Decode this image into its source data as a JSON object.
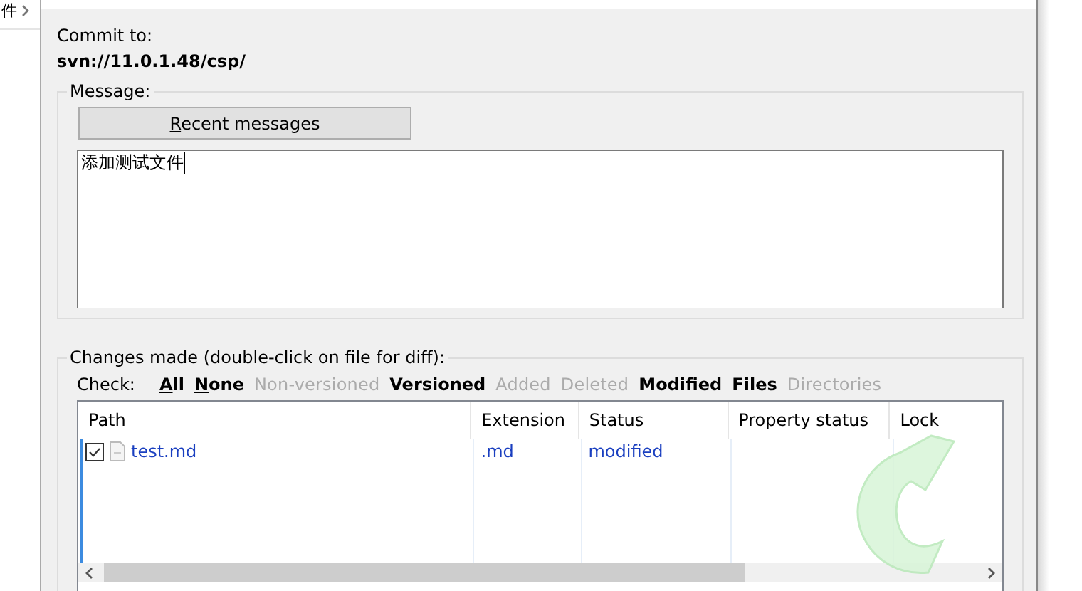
{
  "background": {
    "text": "件"
  },
  "commit_to": {
    "label": "Commit to:",
    "url": "svn://11.0.1.48/csp/"
  },
  "message": {
    "legend": "Message:",
    "recent_button": "Recent messages",
    "value": "添加测试文件"
  },
  "changes": {
    "legend": "Changes made (double-click on file for diff):",
    "check_label": "Check:",
    "filters": [
      {
        "label": "All",
        "enabled": true,
        "mnemonic": true
      },
      {
        "label": "None",
        "enabled": true,
        "mnemonic": true
      },
      {
        "label": "Non-versioned",
        "enabled": false,
        "mnemonic": false
      },
      {
        "label": "Versioned",
        "enabled": true,
        "mnemonic": false
      },
      {
        "label": "Added",
        "enabled": false,
        "mnemonic": false
      },
      {
        "label": "Deleted",
        "enabled": false,
        "mnemonic": false
      },
      {
        "label": "Modified",
        "enabled": true,
        "mnemonic": false
      },
      {
        "label": "Files",
        "enabled": true,
        "mnemonic": false
      },
      {
        "label": "Directories",
        "enabled": false,
        "mnemonic": false
      }
    ],
    "table": {
      "columns": [
        "Path",
        "Extension",
        "Status",
        "Property status",
        "Lock"
      ],
      "rows": [
        {
          "checked": true,
          "path": "test.md",
          "extension": ".md",
          "status": "modified",
          "property_status": "",
          "lock": ""
        }
      ]
    }
  }
}
